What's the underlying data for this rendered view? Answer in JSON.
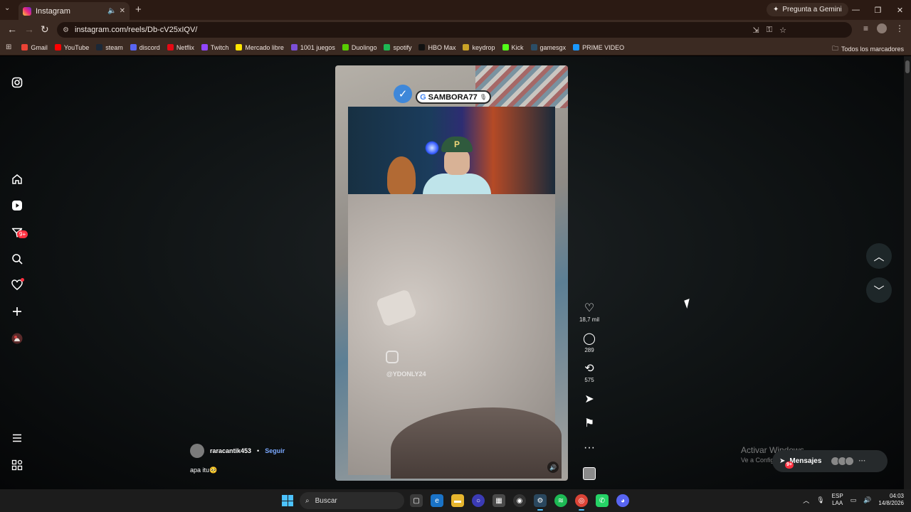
{
  "browser": {
    "tab_title": "Instagram",
    "tab_audio_icon": "speaker-icon",
    "tab_close_icon": "close-icon",
    "new_tab_icon": "plus-icon",
    "gemini_label": "Pregunta a Gemini",
    "url": "instagram.com/reels/Db-cV25xIQV/",
    "window_controls": [
      "minimize-icon",
      "restore-icon",
      "close-icon"
    ]
  },
  "bookmarks": {
    "items": [
      {
        "label": "Gmail",
        "color": "#ea4335"
      },
      {
        "label": "YouTube",
        "color": "#ff0000"
      },
      {
        "label": "steam",
        "color": "#1b2838"
      },
      {
        "label": "discord",
        "color": "#5865f2"
      },
      {
        "label": "Netflix",
        "color": "#e50914"
      },
      {
        "label": "Twitch",
        "color": "#9146ff"
      },
      {
        "label": "Mercado libre",
        "color": "#ffe600"
      },
      {
        "label": "1001 juegos",
        "color": "#7b4fd6"
      },
      {
        "label": "Duolingo",
        "color": "#58cc02"
      },
      {
        "label": "spotify",
        "color": "#1db954"
      },
      {
        "label": "HBO Max",
        "color": "#111111"
      },
      {
        "label": "keydrop",
        "color": "#c9a227"
      },
      {
        "label": "Kick",
        "color": "#53fc18"
      },
      {
        "label": "gamesgx",
        "color": "#2b4d66"
      },
      {
        "label": "PRIME VIDEO",
        "color": "#1a98ff"
      }
    ],
    "all_label": "Todos los marcadores"
  },
  "sidebar": {
    "icons": [
      "instagram-logo-icon",
      "home-icon",
      "reels-icon",
      "direct-messages-icon",
      "search-icon",
      "notifications-icon",
      "create-icon",
      "profile-avatar-icon",
      "menu-icon",
      "more-apps-icon"
    ],
    "messages_badge": "9+"
  },
  "reel": {
    "overlay_name": "SAMBORA77",
    "watermark": "@YDONLY24",
    "author": "raracantik453",
    "separator": "•",
    "follow_label": "Seguir",
    "caption": "apa itu🥺"
  },
  "actions": {
    "likes": "18,7 mil",
    "comments": "289",
    "reposts": "575"
  },
  "overlay": {
    "activate_title": "Activar Windows",
    "activate_sub": "Ve a Configuración para activar Windows.",
    "messages_label": "Mensajes",
    "messages_badge": "9+"
  },
  "taskbar": {
    "search_placeholder": "Buscar",
    "lang_top": "ESP",
    "lang_bottom": "LAA",
    "time": "04:03",
    "date": "14/8/2026",
    "accent": "#4cc2ff"
  }
}
